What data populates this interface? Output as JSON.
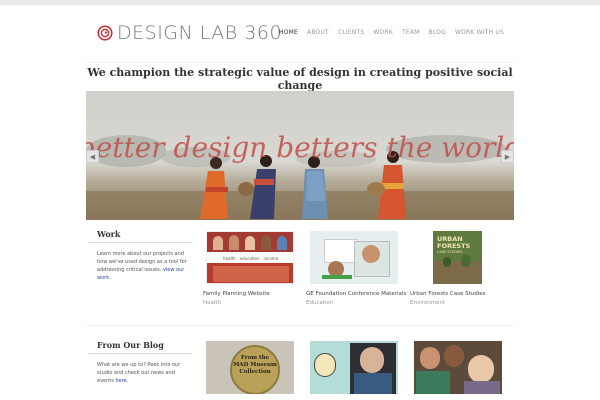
{
  "header": {
    "logo_text": "DESIGN LAB 360",
    "nav": [
      "HOME",
      "ABOUT",
      "CLIENTS",
      "WORK",
      "TEAM",
      "BLOG",
      "WORK WITH US"
    ]
  },
  "tagline": "We champion the strategic value of design in creating positive social change",
  "hero": {
    "overlay_text": "better design betters the world"
  },
  "work": {
    "title": "Work",
    "description": "Learn more about our projects and how we've used design as a tool for addressing critical issues.",
    "link": "view our work.",
    "items": [
      {
        "title": "Family Planning Website",
        "category": "Health",
        "thumb_labels": [
          "health",
          "education",
          "income"
        ]
      },
      {
        "title": "GE Foundation Conference Materials",
        "category": "Education"
      },
      {
        "title": "Urban Forests Case Studies",
        "category": "Environment",
        "thumb_labels": [
          "URBAN",
          "FORESTS",
          "CASE STUDIES"
        ]
      }
    ]
  },
  "blog": {
    "title": "From Our Blog",
    "description": "What are we up to? Peek into our studio and check out news and events",
    "link": "here.",
    "thumb_labels": [
      "From the",
      "MAD Museum",
      "Collection"
    ]
  },
  "colors": {
    "accent_red": "#c8333a",
    "link_blue": "#2246a3"
  }
}
